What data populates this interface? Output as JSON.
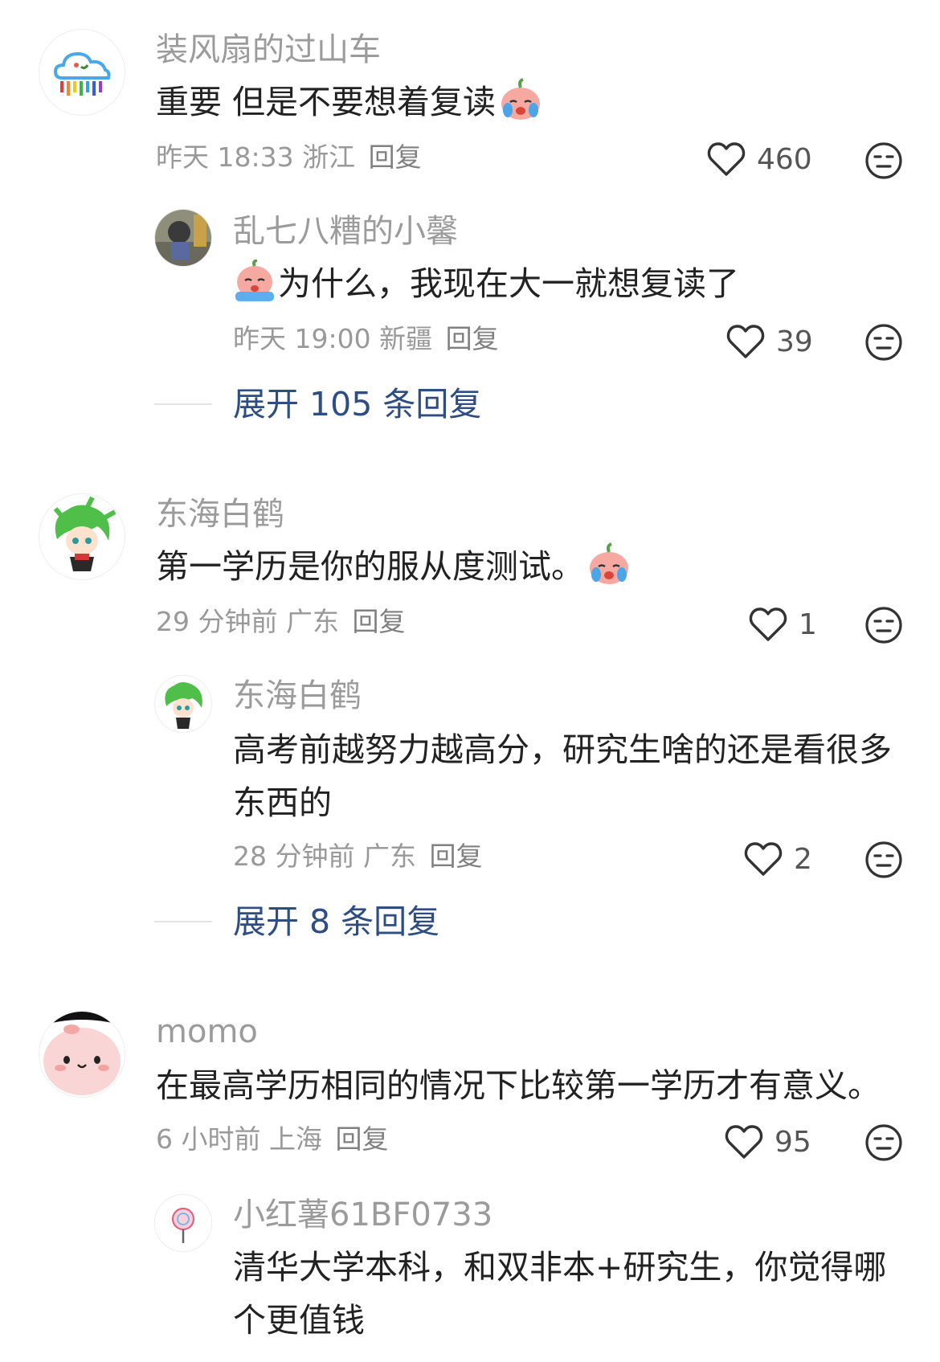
{
  "comments": [
    {
      "user": "装风扇的过山车",
      "text": "重要 但是不要想着复读",
      "time": "昨天 18:33",
      "location": "浙江",
      "reply_label": "回复",
      "likes": "460",
      "replies": [
        {
          "user": "乱七八糟的小馨",
          "text": "为什么，我现在大一就想复读了",
          "time": "昨天 19:00",
          "location": "新疆",
          "reply_label": "回复",
          "likes": "39"
        }
      ],
      "expand_label": "展开 105 条回复"
    },
    {
      "user": "东海白鹤",
      "text": "第一学历是你的服从度测试。",
      "time": "29 分钟前",
      "location": "广东",
      "reply_label": "回复",
      "likes": "1",
      "replies": [
        {
          "user": "东海白鹤",
          "text": "高考前越努力越高分，研究生啥的还是看很多东西的",
          "time": "28 分钟前",
          "location": "广东",
          "reply_label": "回复",
          "likes": "2"
        }
      ],
      "expand_label": "展开 8 条回复"
    },
    {
      "user": "momo",
      "text": "在最高学历相同的情况下比较第一学历才有意义。",
      "time": "6 小时前",
      "location": "上海",
      "reply_label": "回复",
      "likes": "95",
      "replies": [
        {
          "user": "小红薯61BF0733",
          "text": "清华大学本科，和双非本+研究生，你觉得哪个更值钱"
        }
      ]
    }
  ]
}
